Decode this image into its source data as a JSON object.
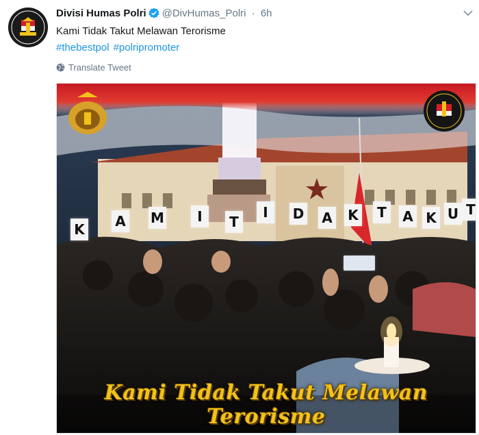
{
  "tweet": {
    "author_name": "Divisi Humas Polri",
    "handle": "@DivHumas_Polri",
    "separator": "·",
    "time": "6h",
    "text": "Kami Tidak Takut Melawan Terorisme",
    "hashtags": [
      "#thebestpol",
      "#polripromoter"
    ],
    "translate_label": "Translate Tweet",
    "media_caption": "Kami Tidak Takut Melawan Terorisme",
    "cards": [
      "K",
      "A",
      "M",
      "I",
      "T",
      "I",
      "D",
      "A",
      "K",
      "T",
      "A",
      "K",
      "U",
      "T"
    ]
  },
  "colors": {
    "name": "#14171a",
    "secondary": "#657786",
    "hashtag": "#1b95e0",
    "verified": "#1da1f2",
    "flag_red": "#d31f26",
    "caption_gold": "#f2c21a"
  },
  "icons": {
    "verified": "verified-badge-icon",
    "globe": "globe-icon",
    "more": "chevron-down-icon"
  }
}
